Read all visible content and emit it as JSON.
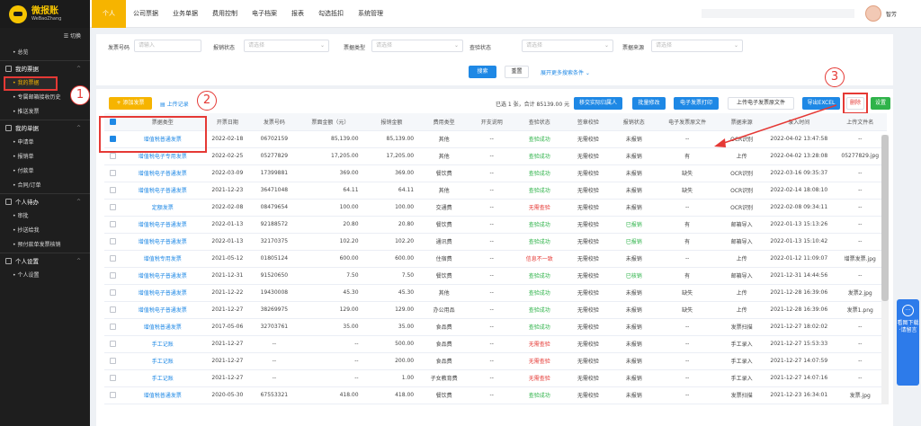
{
  "app": {
    "logo_title": "微报账",
    "logo_sub": "WeBaoZhang",
    "user_name": "智芳"
  },
  "nav": [
    "个人",
    "公司票据",
    "业务单据",
    "费用控制",
    "电子档案",
    "报表",
    "勾选抵扣",
    "系统管理"
  ],
  "sidebar": {
    "toggle": "☰ 切换",
    "overview": "• 总览",
    "groups": [
      {
        "title": "我的票据",
        "items": [
          "• 我的票据",
          "• 专属邮箱接收历史",
          "• 推送发票"
        ]
      },
      {
        "title": "我的单据",
        "items": [
          "• 申请单",
          "• 报销单",
          "• 付款单",
          "• 合同/订单"
        ]
      },
      {
        "title": "个人待办",
        "items": [
          "• 审批",
          "• 抄送给我",
          "• 预付款单发票核销"
        ]
      },
      {
        "title": "个人设置",
        "items": [
          "• 个人设置"
        ]
      }
    ]
  },
  "filters": {
    "invoice_no_label": "发票号码",
    "invoice_no_placeholder": "请输入",
    "reimburse_label": "报销状态",
    "reimburse_placeholder": "请选择",
    "type_label": "票据类型",
    "type_placeholder": "请选择",
    "verify_label": "查验状态",
    "verify_placeholder": "请选择",
    "source_label": "票据来源",
    "source_placeholder": "请选择",
    "search_btn": "搜索",
    "reset_btn": "重置",
    "more": "展开更多搜索条件 ⌄"
  },
  "toolbar": {
    "add_btn": "+ 添加发票",
    "upload_link": "上传记录",
    "summary": "已选 1 张，合计 85139.00 元",
    "btn_scan": "移交实际归属人",
    "btn_batch": "批量修改",
    "btn_print": "电子发票打印",
    "btn_upload_file": "上传电子发票原文件",
    "btn_export": "导出EXCEL",
    "btn_delete": "删除",
    "btn_settings": "设置"
  },
  "annotations": [
    "1",
    "2",
    "3"
  ],
  "table": {
    "headers": [
      "票据类型",
      "开票日期",
      "发票号码",
      "票面金额（元）",
      "报销金额",
      "费用类型",
      "开支说明",
      "查验状态",
      "签章校验",
      "报销状态",
      "电子发票原文件",
      "票据来源",
      "录入时间",
      "上传文件名"
    ],
    "rows": [
      [
        "增值税普通发票",
        "2022-02-18",
        "06702159",
        "85,139.00",
        "85,139.00",
        "其他",
        "--",
        "查验成功",
        "无需校验",
        "未报销",
        "--",
        "OCR识别",
        "2022-04-02 13:47:58",
        "--"
      ],
      [
        "增值税电子专用发票",
        "2022-02-25",
        "05277829",
        "17,205.00",
        "17,205.00",
        "其他",
        "--",
        "查验成功",
        "无需校验",
        "未报销",
        "有",
        "上传",
        "2022-04-02 13:28:08",
        "05277829.jpg"
      ],
      [
        "增值税电子普通发票",
        "2022-03-09",
        "17399881",
        "369.00",
        "369.00",
        "餐饮费",
        "--",
        "查验成功",
        "无需校验",
        "未报销",
        "缺失",
        "OCR识别",
        "2022-03-16 09:35:37",
        "--"
      ],
      [
        "增值税电子普通发票",
        "2021-12-23",
        "36471048",
        "64.11",
        "64.11",
        "其他",
        "--",
        "查验成功",
        "无需校验",
        "未报销",
        "缺失",
        "OCR识别",
        "2022-02-14 18:08:10",
        "--"
      ],
      [
        "定额发票",
        "2022-02-08",
        "08479654",
        "100.00",
        "100.00",
        "交通费",
        "--",
        "无需查验",
        "无需校验",
        "未报销",
        "--",
        "OCR识别",
        "2022-02-08 09:34:11",
        "--"
      ],
      [
        "增值税电子普通发票",
        "2022-01-13",
        "92188572",
        "20.80",
        "20.80",
        "餐饮费",
        "--",
        "查验成功",
        "无需校验",
        "已报销",
        "有",
        "邮箱导入",
        "2022-01-13 15:13:26",
        "--"
      ],
      [
        "增值税电子普通发票",
        "2022-01-13",
        "32170375",
        "102.20",
        "102.20",
        "通讯费",
        "--",
        "查验成功",
        "无需校验",
        "已报销",
        "有",
        "邮箱导入",
        "2022-01-13 15:10:42",
        "--"
      ],
      [
        "增值税专用发票",
        "2021-05-12",
        "01805124",
        "600.00",
        "600.00",
        "住宿费",
        "--",
        "信息不一致",
        "无需校验",
        "未报销",
        "--",
        "上传",
        "2022-01-12 11:09:07",
        "增票发票.jpg"
      ],
      [
        "增值税电子普通发票",
        "2021-12-31",
        "91520650",
        "7.50",
        "7.50",
        "餐饮费",
        "--",
        "查验成功",
        "无需校验",
        "已核销",
        "有",
        "邮箱导入",
        "2021-12-31 14:44:56",
        "--"
      ],
      [
        "增值税电子普通发票",
        "2021-12-22",
        "19430008",
        "45.30",
        "45.30",
        "其他",
        "--",
        "查验成功",
        "无需校验",
        "未报销",
        "缺失",
        "上传",
        "2021-12-28 16:39:06",
        "发票2.jpg"
      ],
      [
        "增值税电子普通发票",
        "2021-12-27",
        "38269975",
        "129.00",
        "129.00",
        "办公用品",
        "--",
        "查验成功",
        "无需校验",
        "未报销",
        "缺失",
        "上传",
        "2021-12-28 16:39:06",
        "发票1.png"
      ],
      [
        "增值税普通发票",
        "2017-05-06",
        "32703761",
        "35.00",
        "35.00",
        "食品费",
        "--",
        "查验成功",
        "无需校验",
        "未报销",
        "--",
        "发票扫描",
        "2021-12-27 18:02:02",
        "--"
      ],
      [
        "手工记账",
        "2021-12-27",
        "--",
        "--",
        "500.00",
        "食品费",
        "--",
        "无需查验",
        "无需校验",
        "未报销",
        "--",
        "手工录入",
        "2021-12-27 15:53:33",
        "--"
      ],
      [
        "手工记账",
        "2021-12-27",
        "--",
        "--",
        "200.00",
        "食品费",
        "--",
        "无需查验",
        "无需校验",
        "未报销",
        "--",
        "手工录入",
        "2021-12-27 14:07:59",
        "--"
      ],
      [
        "手工记账",
        "2021-12-27",
        "--",
        "--",
        "1.00",
        "子女教育费",
        "--",
        "无需查验",
        "无需校验",
        "未报销",
        "--",
        "手工录入",
        "2021-12-27 14:07:16",
        "--"
      ],
      [
        "增值税普通发票",
        "2020-05-30",
        "67553321",
        "418.00",
        "418.00",
        "餐饮费",
        "--",
        "查验成功",
        "无需校验",
        "未报销",
        "--",
        "发票扫描",
        "2021-12-23 16:34:01",
        "发票.jpg"
      ]
    ]
  },
  "float_panel": {
    "icon": "···",
    "text": "看图下载·请留言"
  },
  "colors": {
    "accent": "#f6b400",
    "primary": "#1e88e5",
    "success": "#2fb34a",
    "danger": "#e53935"
  }
}
